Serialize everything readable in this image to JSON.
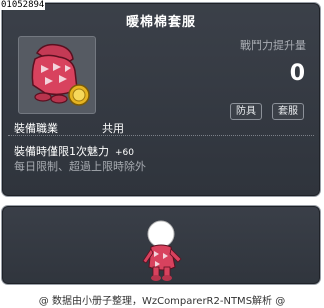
{
  "item_id": "01052894",
  "item": {
    "name": "暖棉棉套服",
    "combat_power_label": "戰鬥力提升量",
    "combat_power_value": "0",
    "tags": [
      "防具",
      "套服"
    ],
    "job_label": "裝備職業",
    "job_value": "共用",
    "effect_text": "裝備時僅限1次魅力",
    "effect_value": "+60",
    "limit_text": "每日限制、超過上限時除外"
  },
  "footer": "@ 数据由小册子整理，WzComparerR2-NTMS解析 @",
  "colors": {
    "panel_bg": "#343942",
    "border": "#9aa0a8",
    "title": "#ffffff",
    "muted": "#a9adb3",
    "accent_pink": "#d8425e"
  }
}
